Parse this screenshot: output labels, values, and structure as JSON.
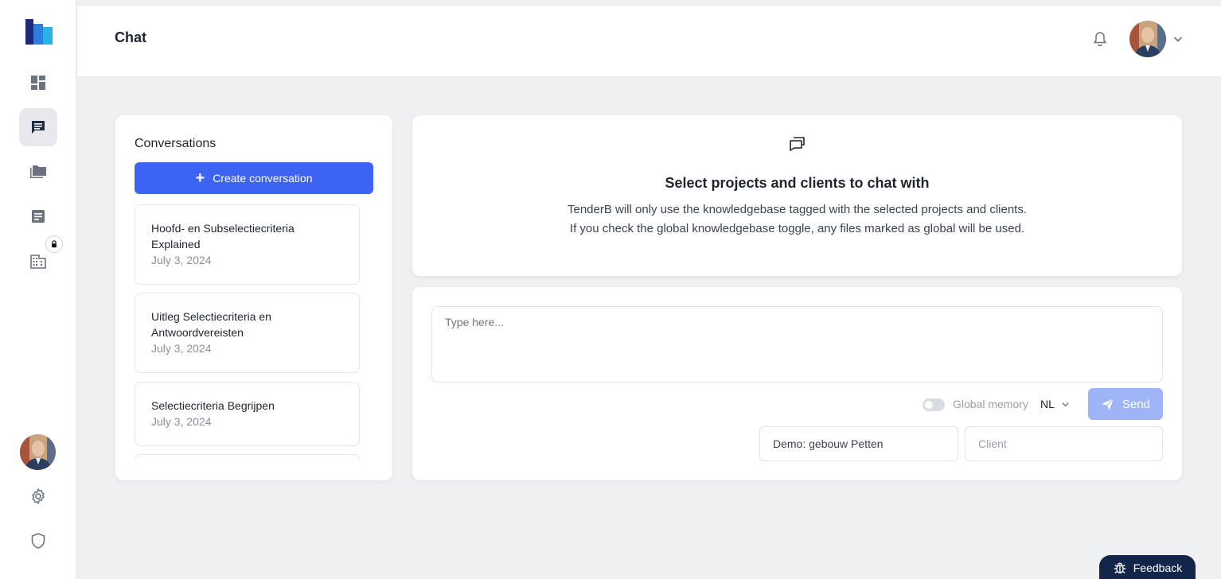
{
  "header": {
    "title": "Chat"
  },
  "sidebar": {
    "items": [
      {
        "name": "dashboard",
        "icon": "dashboard-icon"
      },
      {
        "name": "chat",
        "icon": "chat-icon",
        "active": true
      },
      {
        "name": "folders",
        "icon": "folder-icon"
      },
      {
        "name": "documents",
        "icon": "document-icon"
      },
      {
        "name": "company",
        "icon": "building-icon",
        "locked": true
      }
    ],
    "bottom": [
      {
        "name": "settings",
        "icon": "gear-icon"
      },
      {
        "name": "security",
        "icon": "shield-icon"
      }
    ]
  },
  "conversations": {
    "title": "Conversations",
    "create_label": "Create conversation",
    "items": [
      {
        "title": "Hoofd- en Subselectiecriteria Explained",
        "date": "July 3, 2024"
      },
      {
        "title": "Uitleg Selectiecriteria en Antwoordvereisten",
        "date": "July 3, 2024"
      },
      {
        "title": "Selectiecriteria Begrijpen",
        "date": "July 3, 2024"
      }
    ]
  },
  "info": {
    "title": "Select projects and clients to chat with",
    "description": "TenderB will only use the knowledgebase tagged with the selected projects and clients. If you check the global knowledgebase toggle, any files marked as global will be used."
  },
  "composer": {
    "placeholder": "Type here...",
    "global_memory_label": "Global memory",
    "global_memory_on": false,
    "language": "NL",
    "send_label": "Send",
    "project_value": "Demo: gebouw Petten",
    "client_placeholder": "Client"
  },
  "feedback": {
    "label": "Feedback"
  },
  "colors": {
    "primary": "#3d63f2",
    "send_disabled": "#9fb4f7",
    "feedback_bg": "#14254a",
    "page_bg": "#eef0f2"
  }
}
